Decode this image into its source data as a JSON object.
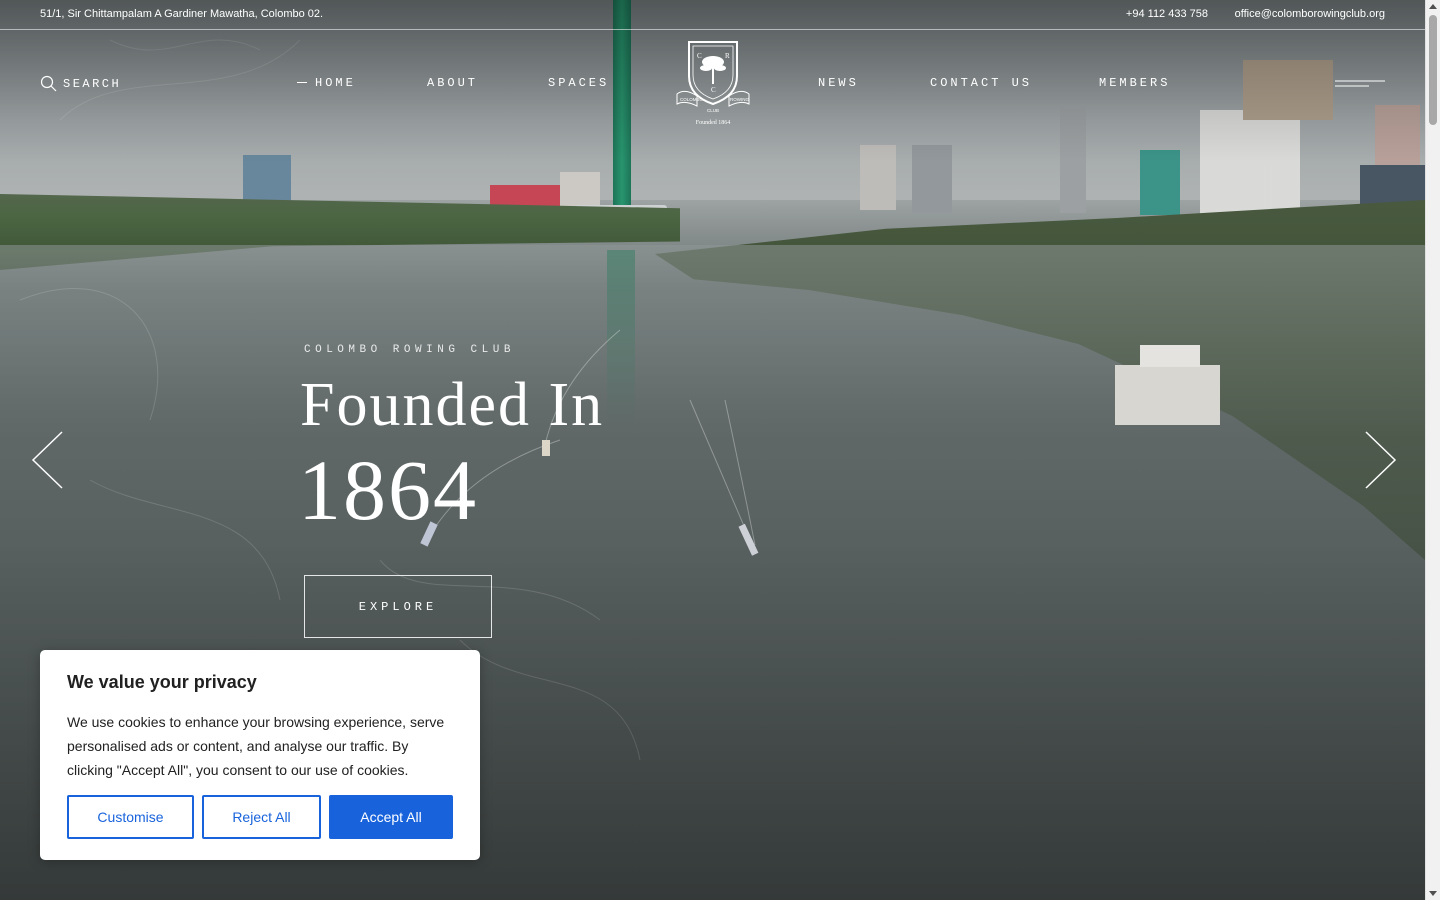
{
  "topbar": {
    "address": "51/1, Sir Chittampalam A Gardiner Mawatha, Colombo 02.",
    "phone": "+94 112 433 758",
    "email": "office@colomborowingclub.org"
  },
  "nav": {
    "search_label": "SEARCH",
    "items": [
      {
        "label": "HOME",
        "active": true
      },
      {
        "label": "ABOUT",
        "active": false
      },
      {
        "label": "SPACES",
        "active": false
      },
      {
        "label": "NEWS",
        "active": false
      },
      {
        "label": "CONTACT US",
        "active": false
      },
      {
        "label": "MEMBERS",
        "active": false
      }
    ],
    "logo": {
      "crest_letters": [
        "C",
        "R",
        "C"
      ],
      "banner_left": "COLOMBO",
      "banner_right": "ROWING",
      "banner_bottom": "CLUB",
      "founded": "Founded 1864"
    }
  },
  "hero": {
    "eyebrow": "COLOMBO ROWING CLUB",
    "headline_line1": "Founded In",
    "headline_line2": "1864",
    "cta_label": "EXPLORE",
    "prev_icon": "chevron-left-icon",
    "next_icon": "chevron-right-icon"
  },
  "cookie_banner": {
    "title": "We value your privacy",
    "body": "We use cookies to enhance your browsing experience, serve personalised ads or content, and analyse our traffic. By clicking \"Accept All\", you consent to our use of cookies.",
    "customise_label": "Customise",
    "reject_label": "Reject All",
    "accept_label": "Accept All"
  },
  "colors": {
    "accent": "#1863dc",
    "tower_green": "#2a9d74",
    "text_white": "#ffffff"
  }
}
